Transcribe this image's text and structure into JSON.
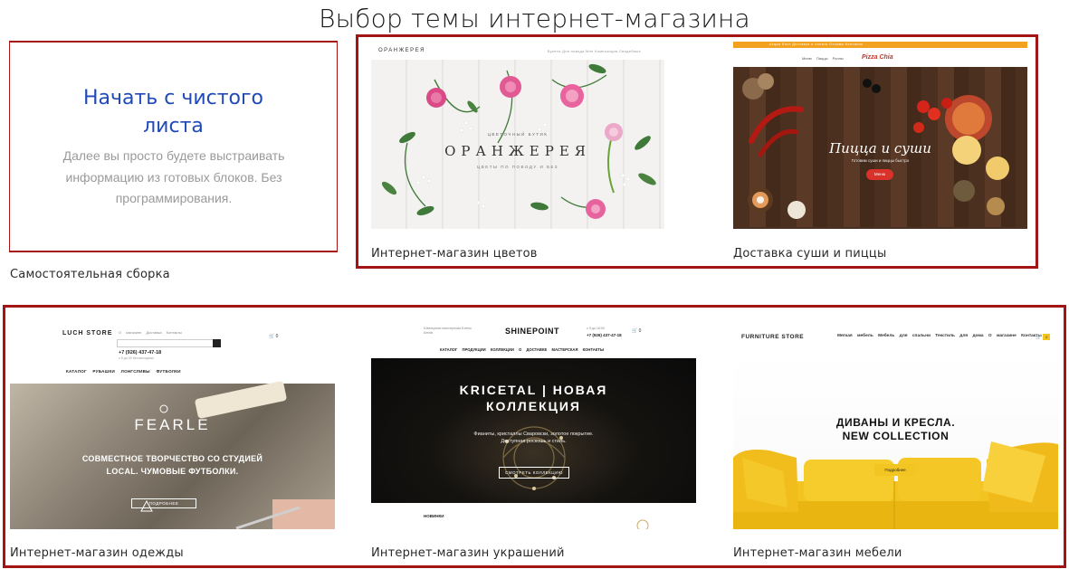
{
  "page": {
    "title": "Выбор темы интернет-магазина"
  },
  "blank": {
    "title_line1": "Начать с чистого",
    "title_line2": "листа",
    "desc_line1": "Далее вы просто будете выстраивать",
    "desc_line2": "информацию из готовых блоков. Без",
    "desc_line3": "программирования.",
    "caption": "Самостоятельная сборка"
  },
  "themes": {
    "flowers": {
      "caption": "Интернет-магазин цветов",
      "logo": "ОРАНЖЕРЕЯ",
      "pre_title": "ЦВЕТОЧНЫЙ БУТИК",
      "title": "ОРАНЖЕРЕЯ",
      "subtitle": "ЦВЕТЫ ПО ПОВОДУ И БЕЗ"
    },
    "sushi": {
      "caption": "Доставка суши и пиццы",
      "logo": "Pizza Chia",
      "title": "Пицца и суши",
      "subtitle": "Готовим суши и пиццы быстро",
      "button": "Меню"
    },
    "clothes": {
      "caption": "Интернет-магазин одежды",
      "logo": "LUCH STORE",
      "top_links": "О магазине  Доставка  Контакты",
      "phone": "+7 (926) 437-47-18",
      "hours": "с 9 до 20 без выходных",
      "menu": "КАТАЛОГ  РУБАШКИ  ЛОНГСЛИВЫ  ФУТБОЛКИ",
      "brand": "FEARLE",
      "line1": "СОВМЕСТНОЕ ТВОРЧЕСТВО СО СТУДИЕЙ",
      "line2": "LOCAL. ЧУМОВЫЕ ФУТБОЛКИ.",
      "button": "ПОДРОБНЕЕ",
      "cart": "0"
    },
    "jewelry": {
      "caption": "Интернет-магазин украшений",
      "logo": "SHINEPOINT",
      "brand_note": "Ювелирная мастерская Елены Бенда",
      "hours": "с 9 до 18:00",
      "phone": "+7 (926) 437-47-18",
      "menu": "КАТАЛОГ ПРОДУКЦИИ  КОЛЛЕКЦИИ  О ДОСТАВКЕ  МАСТЕРСКАЯ  КОНТАКТЫ",
      "title_line1": "KRICETAL | НОВАЯ",
      "title_line2": "КОЛЛЕКЦИЯ",
      "sub_line1": "Фианиты, кристаллы Сваровски, золотое покрытие.",
      "sub_line2": "Доступная роскошь и стиль.",
      "button": "СМОТРЕТЬ КОЛЛЕКЦИЮ",
      "new_label": "НОВИНКИ",
      "cart": "0"
    },
    "furniture": {
      "caption": "Интернет-магазин мебели",
      "logo": "FURNITURE STORE",
      "menu": "Мягкая мебель  Мебель для спальни  Текстиль для дома  О магазине  Контакты",
      "title_line1": "ДИВАНЫ И КРЕСЛА.",
      "title_line2": "NEW COLLECTION",
      "button": "Подробнее",
      "cart": "0"
    }
  },
  "colors": {
    "highlight": "#a31515",
    "accent_blue": "#1f4ab8"
  }
}
